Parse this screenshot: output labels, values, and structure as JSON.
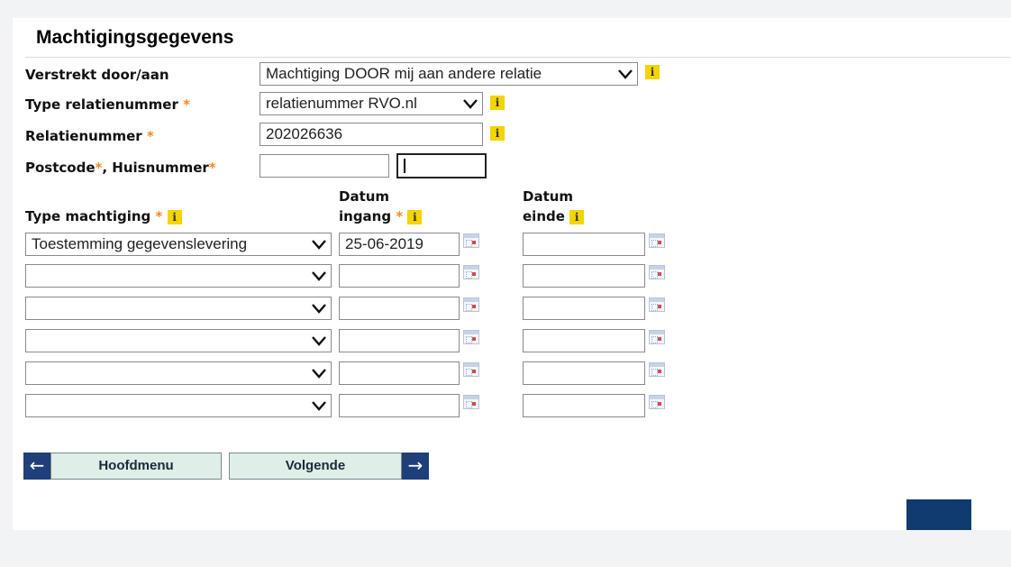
{
  "page": {
    "title": "Machtigingsgegevens"
  },
  "form": {
    "verstrekt": {
      "label": "Verstrekt door/aan",
      "value": "Machtiging DOOR mij aan andere relatie"
    },
    "type_relatienummer": {
      "label": "Type relatienummer",
      "value": "relatienummer RVO.nl"
    },
    "relatienummer": {
      "label": "Relatienummer",
      "value": "202026636"
    },
    "postcode_huisnummer": {
      "label_postcode": "Postcode",
      "label_huisnummer": ", Huisnummer",
      "postcode_value": "",
      "huisnummer_value": ""
    },
    "required_mark": "*",
    "info_glyph": "i"
  },
  "table": {
    "col_type": "Type machtiging",
    "col_ingang_1": "Datum",
    "col_ingang_2": "ingang",
    "col_einde_1": "Datum",
    "col_einde_2": "einde",
    "rows": [
      {
        "type": "Toestemming gegevenslevering",
        "ingang": "25-06-2019",
        "einde": ""
      },
      {
        "type": "",
        "ingang": "",
        "einde": ""
      },
      {
        "type": "",
        "ingang": "",
        "einde": ""
      },
      {
        "type": "",
        "ingang": "",
        "einde": ""
      },
      {
        "type": "",
        "ingang": "",
        "einde": ""
      },
      {
        "type": "",
        "ingang": "",
        "einde": ""
      }
    ]
  },
  "buttons": {
    "back_label": "Hoofdmenu",
    "next_label": "Volgende",
    "back_arrow": "←",
    "next_arrow": "→"
  },
  "colors": {
    "accent_navy": "#1e3f78",
    "info_yellow": "#f5d400",
    "required_orange": "#f08a24"
  }
}
